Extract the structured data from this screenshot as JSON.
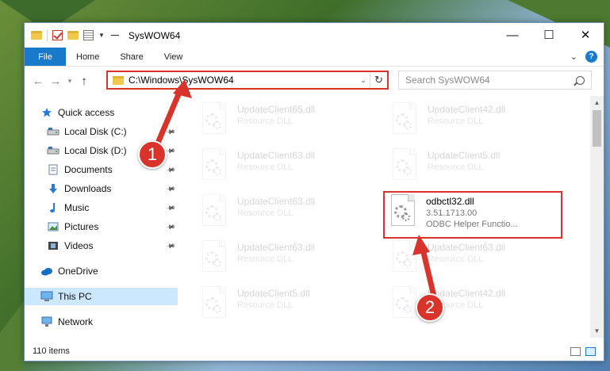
{
  "window": {
    "title": "SysWOW64",
    "controls": {
      "minimize": "—",
      "maximize": "☐",
      "close": "✕"
    }
  },
  "ribbon": {
    "tabs": [
      "File",
      "Home",
      "Share",
      "View"
    ],
    "help": "?"
  },
  "address": {
    "path": "C:\\Windows\\SysWOW64",
    "search_placeholder": "Search SysWOW64"
  },
  "nav": {
    "items": [
      {
        "label": "Quick access",
        "icon": "star-icon",
        "pinned": false
      },
      {
        "label": "Local Disk (C:)",
        "icon": "drive-icon",
        "pinned": true
      },
      {
        "label": "Local Disk (D:)",
        "icon": "drive-icon",
        "pinned": true
      },
      {
        "label": "Documents",
        "icon": "documents-icon",
        "pinned": true
      },
      {
        "label": "Downloads",
        "icon": "download-arrow-icon",
        "pinned": true
      },
      {
        "label": "Music",
        "icon": "music-note-icon",
        "pinned": true
      },
      {
        "label": "Pictures",
        "icon": "pictures-icon",
        "pinned": true
      },
      {
        "label": "Videos",
        "icon": "videos-icon",
        "pinned": true
      },
      {
        "label": "OneDrive",
        "icon": "cloud-icon",
        "pinned": false
      },
      {
        "label": "This PC",
        "icon": "computer-icon",
        "pinned": false,
        "selected": true
      },
      {
        "label": "Network",
        "icon": "network-icon",
        "pinned": false
      }
    ]
  },
  "files": [
    {
      "name": "UpdateClient65.dll",
      "sub": "Resource DLL"
    },
    {
      "name": "UpdateClient42.dll",
      "sub": "Resource DLL"
    },
    {
      "name": "UpdateClient63.dll",
      "sub": "Resource DLL"
    },
    {
      "name": "UpdateClient5.dll",
      "sub": "Resource DLL"
    },
    {
      "name": "UpdateClient63.dll",
      "sub": "Resource DLL"
    },
    {
      "name": "odbctl32.dll",
      "sub": "3.51.1713.00",
      "sub2": "ODBC Helper Functio...",
      "highlighted": true
    },
    {
      "name": "UpdateClient63.dll",
      "sub": "Resource DLL"
    },
    {
      "name": "UpdateClient63.dll",
      "sub": "Resource DLL"
    },
    {
      "name": "UpdateClient5.dll",
      "sub": "Resource DLL"
    },
    {
      "name": "UpdateClient42.dll",
      "sub": "Resource DLL"
    }
  ],
  "status": {
    "count": "110 items"
  },
  "annotations": {
    "step1": "1",
    "step2": "2",
    "color": "#d9342b"
  }
}
